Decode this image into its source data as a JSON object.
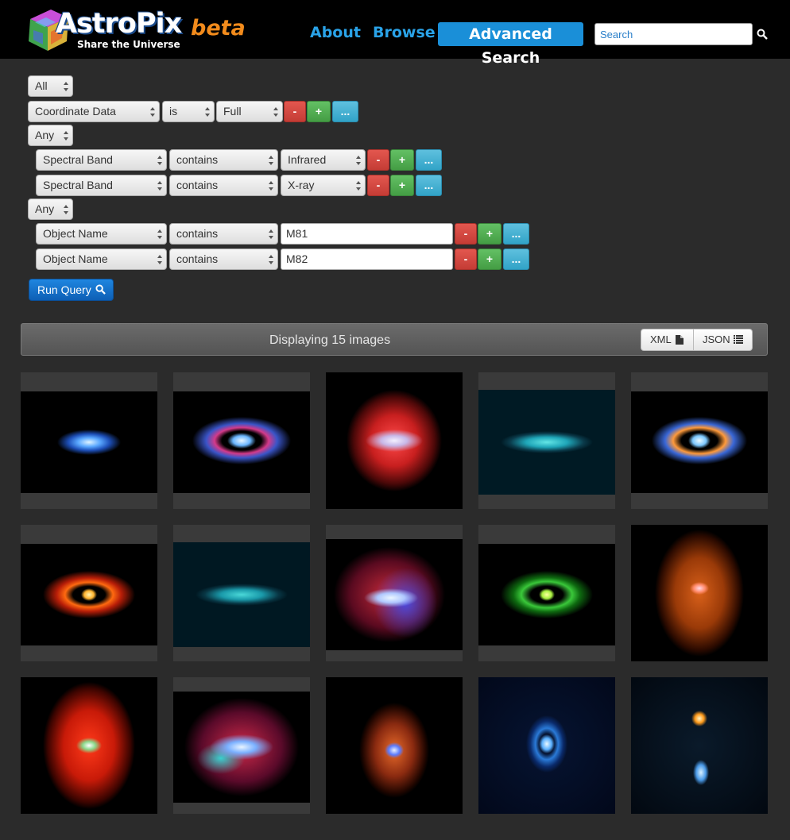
{
  "header": {
    "logo_text": "AstroPix",
    "logo_beta": "beta",
    "tagline": "Share the Universe",
    "nav": {
      "about": "About",
      "browse": "Browse",
      "advanced": "Advanced Search"
    },
    "search_placeholder": "Search",
    "accent": "#1a8fd8"
  },
  "query": {
    "top_group": "All",
    "rule1": {
      "field": "Coordinate Data",
      "op": "is",
      "value": "Full"
    },
    "group1": {
      "combinator": "Any",
      "rules": [
        {
          "field": "Spectral Band",
          "op": "contains",
          "value": "Infrared"
        },
        {
          "field": "Spectral Band",
          "op": "contains",
          "value": "X-ray"
        }
      ]
    },
    "group2": {
      "combinator": "Any",
      "rules": [
        {
          "field": "Object Name",
          "op": "contains",
          "value": "M81"
        },
        {
          "field": "Object Name",
          "op": "contains",
          "value": "M82"
        }
      ]
    },
    "button_minus": "-",
    "button_plus": "+",
    "button_more": "...",
    "run_label": "Run Query"
  },
  "results": {
    "status": "Displaying 15 images",
    "xml_label": "XML",
    "json_label": "JSON"
  }
}
